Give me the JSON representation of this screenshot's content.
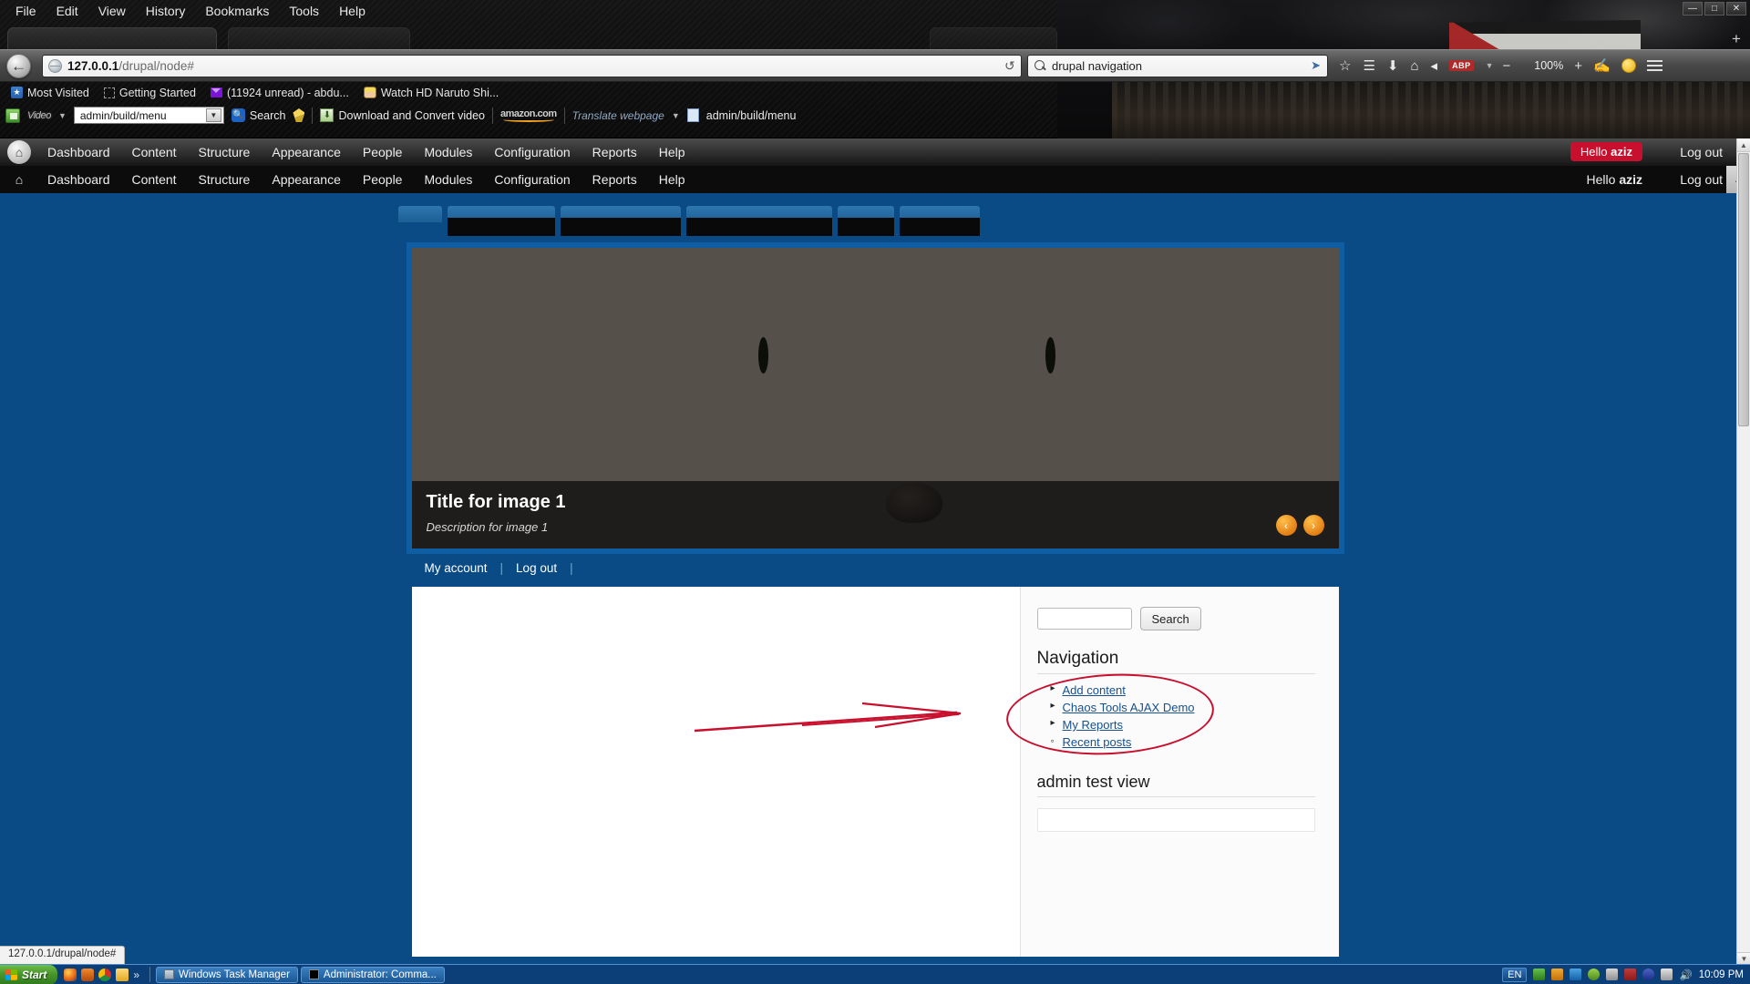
{
  "browser": {
    "menu_items": [
      "File",
      "Edit",
      "View",
      "History",
      "Bookmarks",
      "Tools",
      "Help"
    ],
    "url_host": "127.0.0.1",
    "url_path": "/drupal/node#",
    "search_query": "drupal navigation",
    "zoom_level": "100%",
    "abp_label": "ABP",
    "bookmarks": [
      {
        "label": "Most Visited",
        "icon": "star-icon"
      },
      {
        "label": "Getting Started",
        "icon": "dashed-box-icon"
      },
      {
        "label": "(11924 unread) - abdu...",
        "icon": "mail-icon"
      },
      {
        "label": "Watch HD Naruto Shi...",
        "icon": "naruto-icon"
      }
    ],
    "extensions": {
      "toolbar_logo": "Video",
      "select_value": "admin/build/menu",
      "search_label": "Search",
      "download_label": "Download and Convert video",
      "amazon_label": "amazon.com",
      "translate_label": "Translate webpage",
      "page_label": "admin/build/menu"
    },
    "status_text": "127.0.0.1/drupal/node#"
  },
  "drupal": {
    "toolbar_primary": [
      "Dashboard",
      "Content",
      "Structure",
      "Appearance",
      "People",
      "Modules",
      "Configuration",
      "Reports",
      "Help"
    ],
    "toolbar_secondary": [
      "Dashboard",
      "Content",
      "Structure",
      "Appearance",
      "People",
      "Modules",
      "Configuration",
      "Reports",
      "Help"
    ],
    "hello_prefix": "Hello ",
    "hello_user": "aziz",
    "logout_label": "Log out",
    "banner": {
      "title": "Title for image 1",
      "description": "Description for image 1",
      "prev_arrow": "‹",
      "next_arrow": "›"
    },
    "secondary_menu": [
      "My account",
      "Log out"
    ],
    "sidebar": {
      "search_placeholder": "",
      "search_value": "",
      "search_button": "Search",
      "navigation_title": "Navigation",
      "navigation_links": [
        {
          "label": "Add content",
          "type": "expandable"
        },
        {
          "label": "Chaos Tools AJAX Demo",
          "type": "expandable"
        },
        {
          "label": "My Reports",
          "type": "expandable"
        },
        {
          "label": "Recent posts",
          "type": "leaf"
        }
      ],
      "view_title": "admin test view"
    }
  },
  "taskbar": {
    "start_label": "Start",
    "tasks": [
      {
        "label": "Windows Task Manager",
        "icon": "task-manager-icon"
      },
      {
        "label": "Administrator: Comma...",
        "icon": "command-prompt-icon"
      }
    ],
    "language": "EN",
    "clock": "10:09 PM"
  },
  "annotation": {
    "highlight_color": "#c8102e",
    "shape": "ellipse-around-navigation-links"
  }
}
